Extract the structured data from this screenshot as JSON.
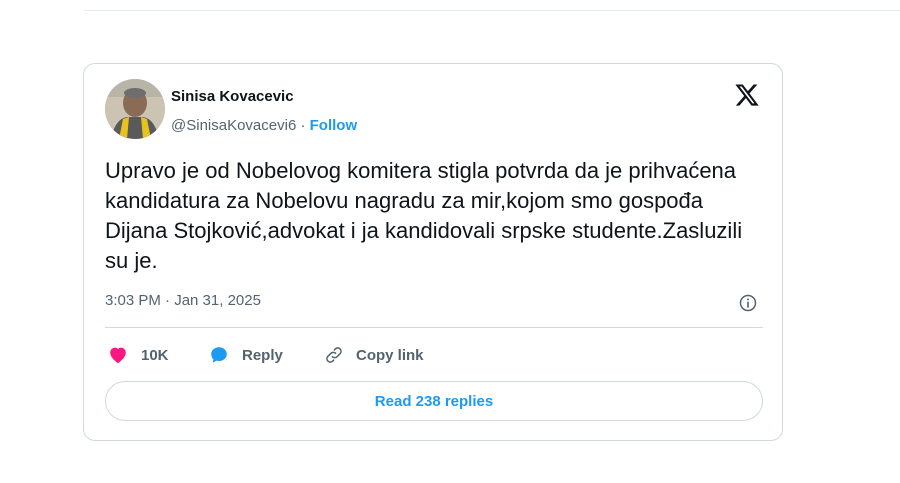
{
  "tweet": {
    "author_name": "Sinisa Kovacevic",
    "handle": "@SinisaKovacevi6",
    "separator": " · ",
    "follow_label": "Follow",
    "text": "Upravo je od Nobelovog komitera stigla potvrda da je prihvaćena kandidatura za Nobelovu nagradu za mir,kojom smo gospođa Dijana Stojković,advokat i ja kandidovali srpske studente.Zasluzili su je.",
    "timestamp": "3:03 PM · Jan 31, 2025"
  },
  "actions": {
    "like_count": "10K",
    "reply_label": "Reply",
    "copy_label": "Copy link"
  },
  "read_replies_label": "Read 238 replies",
  "icons": [
    "x-logo-icon",
    "info-icon",
    "heart-icon",
    "reply-bubble-icon",
    "link-icon"
  ],
  "colors": {
    "accent": "#1d9bf0",
    "like": "#f91880",
    "text": "#0f1419",
    "secondary": "#536471",
    "border": "#cfd9de"
  }
}
